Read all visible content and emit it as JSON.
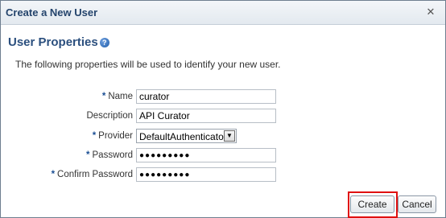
{
  "dialog": {
    "title": "Create a New User",
    "close_glyph": "✕"
  },
  "section": {
    "title": "User Properties",
    "help_glyph": "?",
    "description": "The following properties will be used to identify your new user."
  },
  "form": {
    "required_marker": "*",
    "name_label": "Name",
    "name_value": "curator",
    "description_label": "Description",
    "description_value": "API Curator",
    "provider_label": "Provider",
    "provider_value": "DefaultAuthenticator",
    "password_label": "Password",
    "password_value": "●●●●●●●●●",
    "confirm_label": "Confirm Password",
    "confirm_value": "●●●●●●●●●"
  },
  "buttons": {
    "create": "Create",
    "cancel": "Cancel"
  },
  "colors": {
    "title_text": "#24446c",
    "highlight_border": "#e01010"
  }
}
